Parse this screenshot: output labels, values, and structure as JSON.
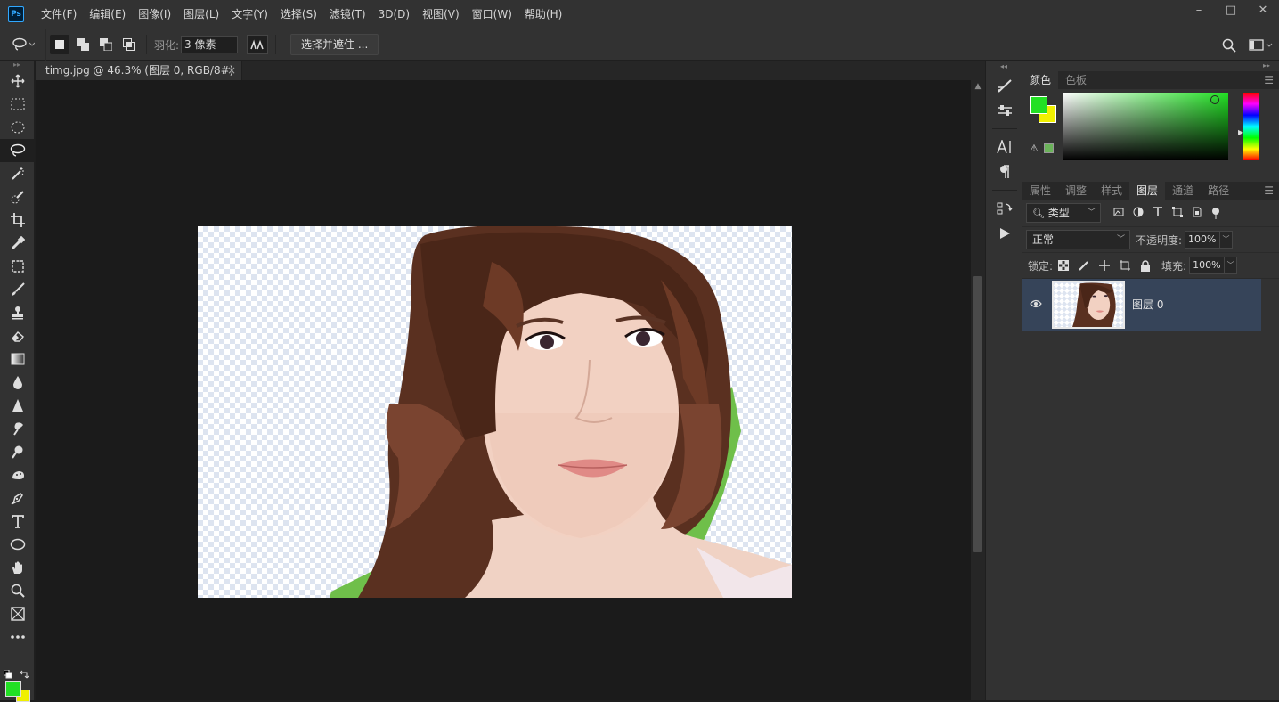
{
  "app": {
    "logo": "Ps"
  },
  "menu": [
    "文件(F)",
    "编辑(E)",
    "图像(I)",
    "图层(L)",
    "文字(Y)",
    "选择(S)",
    "滤镜(T)",
    "3D(D)",
    "视图(V)",
    "窗口(W)",
    "帮助(H)"
  ],
  "window_controls": {
    "minimize": "–",
    "maximize": "□",
    "close": "✕"
  },
  "options": {
    "feather_label": "羽化:",
    "feather_value": "3 像素",
    "select_mask_label": "选择并遮住 ..."
  },
  "document": {
    "tab_title": "timg.jpg @ 46.3% (图层 0, RGB/8#) *",
    "close": "×"
  },
  "panels": {
    "color_tabs": [
      "颜色",
      "色板"
    ],
    "layer_tabs": [
      "属性",
      "调整",
      "样式",
      "图层",
      "通道",
      "路径"
    ],
    "filter_kind": "类型",
    "blend_mode": "正常",
    "opacity_label": "不透明度:",
    "opacity_value": "100%",
    "lock_label": "锁定:",
    "fill_label": "填充:",
    "fill_value": "100%",
    "layer_name": "图层 0"
  },
  "colors": {
    "foreground": "#22e024",
    "background": "#f0f000",
    "ps_blue": "#31a8ff",
    "layer_selected": "#364459"
  },
  "icons": [
    "lasso-icon",
    "move-icon",
    "marquee-icon",
    "ellipse-marquee-icon",
    "magic-wand-icon",
    "quick-select-icon",
    "crop-icon",
    "eyedropper-icon",
    "frame-icon",
    "brush-icon",
    "stamp-icon",
    "eraser-icon",
    "gradient-icon",
    "blur-icon",
    "dodge-icon",
    "smudge-icon",
    "burn-icon",
    "sponge-icon",
    "pen-icon",
    "type-icon",
    "shape-icon",
    "hand-icon",
    "zoom-icon",
    "artboard-icon",
    "more-icon",
    "search-icon",
    "workspace-icon",
    "eye-icon"
  ]
}
